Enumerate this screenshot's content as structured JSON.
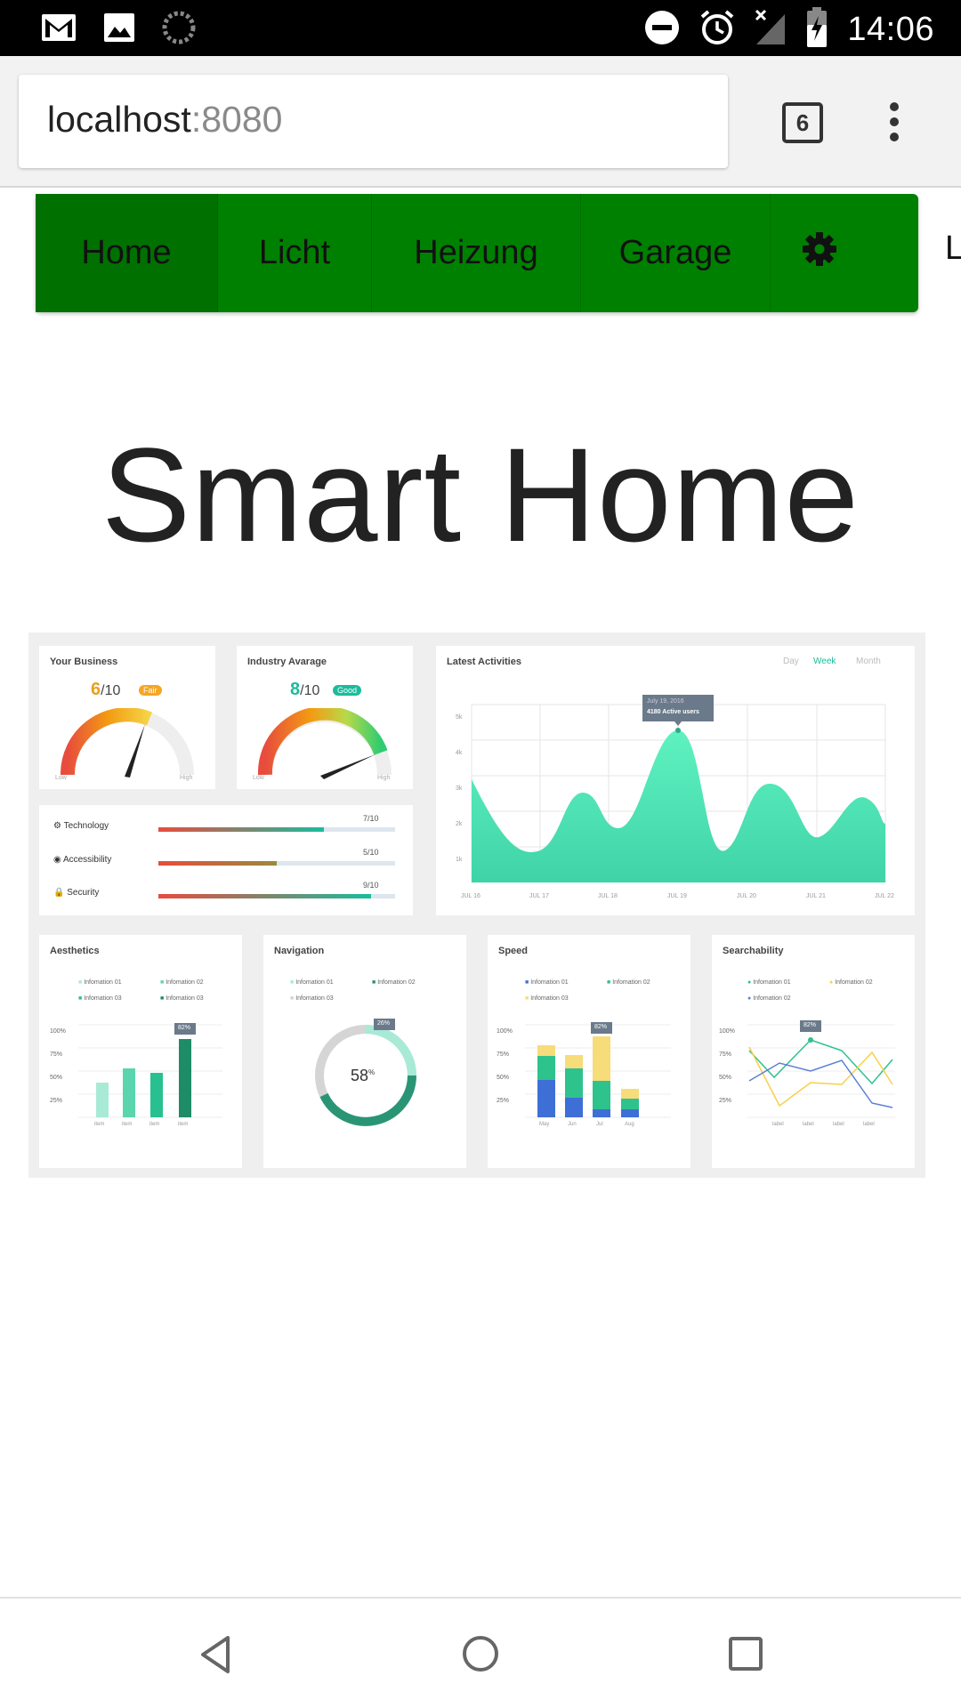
{
  "status_bar": {
    "time": "14:06",
    "left_icons": [
      "gmail-icon",
      "image-icon",
      "sync-icon"
    ],
    "right_icons": [
      "dnd-icon",
      "alarm-icon",
      "signal-off-icon",
      "battery-charging-icon"
    ]
  },
  "browser": {
    "url_host": "localhost",
    "url_port": ":8080",
    "tab_count": "6"
  },
  "nav": {
    "items": [
      {
        "label": "Home"
      },
      {
        "label": "Licht"
      },
      {
        "label": "Heizung"
      },
      {
        "label": "Garage"
      }
    ],
    "settings_icon": "gear-icon",
    "overflow_label": "L",
    "active_color": "#008000"
  },
  "page": {
    "title": "Smart Home"
  },
  "dashboard": {
    "your_business": {
      "title": "Your Business",
      "score": "6",
      "of": "/10",
      "badge": "Fair",
      "low": "Low",
      "high": "High"
    },
    "industry": {
      "title": "Industry Avarage",
      "score": "8",
      "of": "/10",
      "badge": "Good",
      "low": "Low",
      "high": "High"
    },
    "latest": {
      "title": "Latest Activities",
      "tabs": [
        "Day",
        "Week",
        "Month"
      ],
      "tooltip_date": "July 19, 2016",
      "tooltip_value": "4180 Active users",
      "y_ticks": [
        "5k",
        "4k",
        "3k",
        "2k",
        "1k"
      ],
      "x_ticks": [
        "JUL 16",
        "JUL 17",
        "JUL 18",
        "JUL 19",
        "JUL 20",
        "JUL 21",
        "JUL 22"
      ]
    },
    "metrics": [
      {
        "label": "Technology",
        "value": "7/10",
        "fill": 0.7
      },
      {
        "label": "Accessibility",
        "value": "5/10",
        "fill": 0.5
      },
      {
        "label": "Security",
        "value": "9/10",
        "fill": 0.9
      }
    ],
    "aesthetics": {
      "title": "Aesthetics",
      "legend": [
        "Infomation 01",
        "Infomation 02",
        "Infomation 03",
        "Infomation 03"
      ],
      "y_ticks": [
        "100%",
        "75%",
        "50%",
        "25%"
      ],
      "x_ticks": [
        "item",
        "item",
        "item",
        "item"
      ],
      "tooltip": "82%"
    },
    "navigation": {
      "title": "Navigation",
      "legend": [
        "Infomation 01",
        "Infomation 02",
        "Infomation 03"
      ],
      "value": "58",
      "unit": "%",
      "tooltip": "26%"
    },
    "speed": {
      "title": "Speed",
      "legend": [
        "Infomation 01",
        "Infomation 02",
        "Infomation 03"
      ],
      "y_ticks": [
        "100%",
        "75%",
        "50%",
        "25%"
      ],
      "x_ticks": [
        "May",
        "Jun",
        "Jul",
        "Aug"
      ],
      "tooltip": "82%"
    },
    "searchability": {
      "title": "Searchability",
      "legend": [
        "Infomation 01",
        "Infomation 02",
        "Infomation 02"
      ],
      "y_ticks": [
        "100%",
        "75%",
        "50%",
        "25%"
      ],
      "x_ticks": [
        "label",
        "label",
        "label",
        "label"
      ],
      "tooltip": "82%"
    }
  }
}
